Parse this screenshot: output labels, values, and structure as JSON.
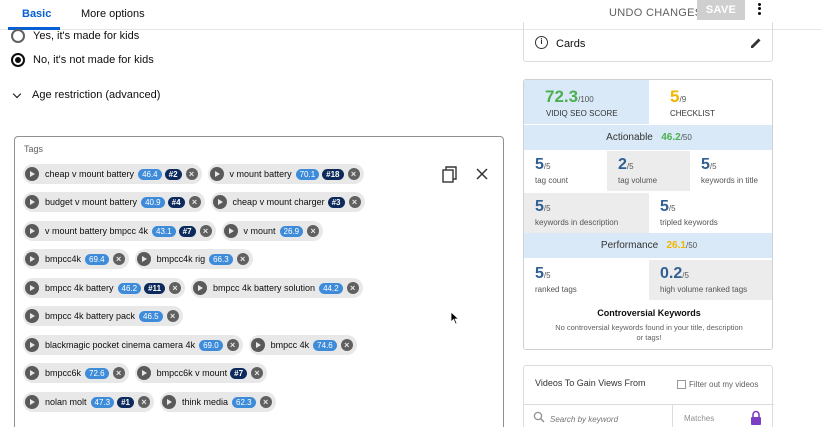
{
  "header": {
    "tabs": [
      {
        "label": "Basic"
      },
      {
        "label": "More options"
      }
    ],
    "undo_label": "UNDO CHANGES",
    "save_label": "SAVE",
    "menu_icon": "kebab-icon"
  },
  "audience": {
    "option_kids": "Yes, it's made for kids",
    "option_not_kids": "No, it's not made for kids",
    "selected": "No, it's not made for kids"
  },
  "age_restriction": {
    "label": "Age restriction (advanced)"
  },
  "tags": {
    "label": "Tags",
    "rows": [
      [
        {
          "text": "cheap v mount battery",
          "score": "46.4",
          "rank": "#2"
        },
        {
          "text": "v mount battery",
          "score": "70.1",
          "rank": "#18"
        }
      ],
      [
        {
          "text": "budget v mount battery",
          "score": "40.9",
          "rank": "#4"
        },
        {
          "text": "cheap v mount charger",
          "score": "",
          "rank": "#3"
        }
      ],
      [
        {
          "text": "v mount battery bmpcc 4k",
          "score": "43.1",
          "rank": "#7"
        },
        {
          "text": "v mount",
          "score": "26.9",
          "rank": ""
        }
      ],
      [
        {
          "text": "bmpcc4k",
          "score": "69.4",
          "rank": ""
        },
        {
          "text": "bmpcc4k rig",
          "score": "66.3",
          "rank": ""
        }
      ],
      [
        {
          "text": "bmpcc 4k battery",
          "score": "46.2",
          "rank": "#11"
        },
        {
          "text": "bmpcc 4k battery solution",
          "score": "44.2",
          "rank": ""
        }
      ],
      [
        {
          "text": "bmpcc 4k battery pack",
          "score": "46.5",
          "rank": ""
        }
      ],
      [
        {
          "text": "blackmagic pocket cinema camera 4k",
          "score": "69.0",
          "rank": ""
        },
        {
          "text": "bmpcc 4k",
          "score": "74.6",
          "rank": ""
        }
      ],
      [
        {
          "text": "bmpcc6k",
          "score": "72.6",
          "rank": ""
        },
        {
          "text": "bmpcc6k v mount",
          "score": "",
          "rank": "#7"
        }
      ],
      [
        {
          "text": "nolan molt",
          "score": "47.3",
          "rank": "#1"
        },
        {
          "text": "think media",
          "score": "62.3",
          "rank": ""
        }
      ]
    ]
  },
  "cards": {
    "label": "Cards"
  },
  "vidiq": {
    "seo_score": "72.3",
    "seo_max": "/100",
    "seo_label": "VIDIQ SEO SCORE",
    "checklist_value": "5",
    "checklist_max": "/9",
    "checklist_label": "CHECKLIST",
    "actionable_label": "Actionable",
    "actionable_value": "46.2",
    "actionable_max": "/50",
    "actionable_metrics": [
      {
        "value": "5",
        "max": "/5",
        "label": "tag count"
      },
      {
        "value": "2",
        "max": "/5",
        "label": "tag volume"
      },
      {
        "value": "5",
        "max": "/5",
        "label": "keywords in title"
      },
      {
        "value": "5",
        "max": "/5",
        "label": "keywords in description"
      },
      {
        "value": "5",
        "max": "/5",
        "label": "tripled keywords"
      }
    ],
    "performance_label": "Performance",
    "performance_value": "26.1",
    "performance_max": "/50",
    "performance_metrics": [
      {
        "value": "5",
        "max": "/5",
        "label": "ranked tags"
      },
      {
        "value": "0.2",
        "max": "/5",
        "label": "high volume ranked tags"
      }
    ],
    "controversial_title": "Controversial Keywords",
    "controversial_text": "No controversial keywords found in your title, description or tags!",
    "colors": {
      "seo": "#4caf50",
      "checklist": "#f2b500",
      "metric": "#2f5f93",
      "header_bg": "#d9e9f7"
    }
  },
  "gain_views": {
    "title": "Videos To Gain Views From",
    "filter_label": "Filter out my videos",
    "search_placeholder": "Search by keyword",
    "matches_label": "Matches"
  }
}
